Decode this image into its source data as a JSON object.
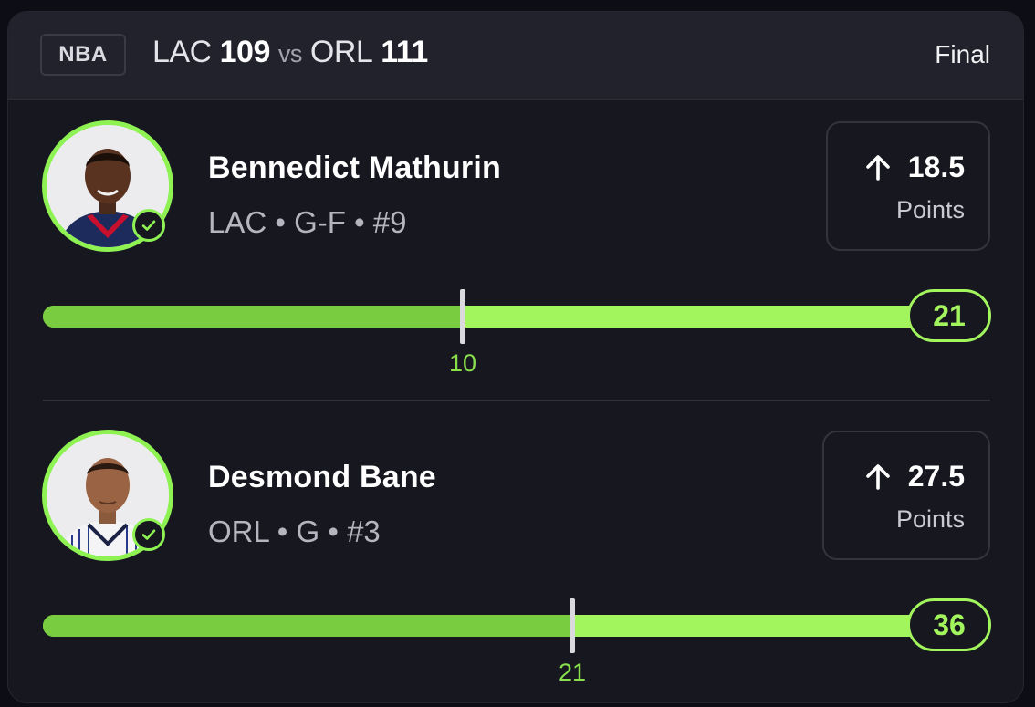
{
  "game": {
    "league": "NBA",
    "home_team": "LAC",
    "home_score": "109",
    "vs_text": "vs",
    "away_team": "ORL",
    "away_score": "111",
    "status": "Final"
  },
  "players": [
    {
      "name": "Bennedict Mathurin",
      "meta": "LAC • G-F • #9",
      "line_value": "18.5",
      "line_direction": "up-arrow-icon",
      "line_label": "Points",
      "final_value": "21",
      "marker_label": "10",
      "progress_fraction": 0.46,
      "jersey_color": "#c8102e"
    },
    {
      "name": "Desmond Bane",
      "meta": "ORL • G • #3",
      "line_value": "27.5",
      "line_direction": "up-arrow-icon",
      "line_label": "Points",
      "final_value": "36",
      "marker_label": "21",
      "progress_fraction": 0.58,
      "jersey_color": "#f4f4f6"
    }
  ],
  "colors": {
    "accent": "#8ef253",
    "bar_light": "#a2f55d",
    "bar_dark": "#79cc40",
    "background": "#171720"
  }
}
